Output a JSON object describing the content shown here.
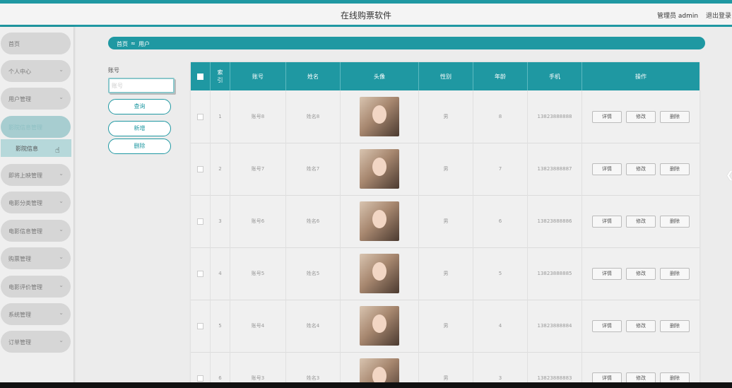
{
  "app": {
    "title": "在线购票软件",
    "admin_text": "管理员 admin",
    "logout": "退出登录"
  },
  "sidebar": {
    "items": [
      {
        "label": "首页",
        "chevron": ""
      },
      {
        "label": "个人中心",
        "chevron": "⌄"
      },
      {
        "label": "用户管理",
        "chevron": "⌄"
      },
      {
        "label": "影院信息管理",
        "chevron": ""
      },
      {
        "label": "即将上映管理",
        "chevron": "⌄"
      },
      {
        "label": "电影分类管理",
        "chevron": "⌄"
      },
      {
        "label": "电影信息管理",
        "chevron": "⌄"
      },
      {
        "label": "购票管理",
        "chevron": "⌄"
      },
      {
        "label": "电影评价管理",
        "chevron": "⌄"
      },
      {
        "label": "系统管理",
        "chevron": "⌄"
      },
      {
        "label": "订单管理",
        "chevron": "⌄"
      }
    ],
    "active_sub": "影院信息"
  },
  "breadcrumb": {
    "home": "首页",
    "sep": "≈",
    "current": "用户"
  },
  "search": {
    "label": "账号",
    "placeholder": "账号",
    "query": "查询",
    "add": "新增",
    "delete": "删除"
  },
  "table": {
    "headers": {
      "index": "索引",
      "account": "账号",
      "name": "姓名",
      "avatar": "头像",
      "gender": "性别",
      "age": "年龄",
      "phone": "手机",
      "ops": "操作"
    },
    "rows": [
      {
        "index": "1",
        "account": "账号8",
        "name": "姓名8",
        "gender": "男",
        "age": "8",
        "phone": "13823888888"
      },
      {
        "index": "2",
        "account": "账号7",
        "name": "姓名7",
        "gender": "男",
        "age": "7",
        "phone": "13823888887"
      },
      {
        "index": "3",
        "account": "账号6",
        "name": "姓名6",
        "gender": "男",
        "age": "6",
        "phone": "13823888886"
      },
      {
        "index": "4",
        "account": "账号5",
        "name": "姓名5",
        "gender": "男",
        "age": "5",
        "phone": "13823888885"
      },
      {
        "index": "5",
        "account": "账号4",
        "name": "姓名4",
        "gender": "男",
        "age": "4",
        "phone": "13823888884"
      },
      {
        "index": "6",
        "account": "账号3",
        "name": "姓名3",
        "gender": "男",
        "age": "3",
        "phone": "13823888883"
      }
    ],
    "actions": {
      "detail": "详情",
      "edit": "修改",
      "delete": "删除"
    }
  },
  "icons": {
    "cursor": "pointer-cursor-icon",
    "chevron": "chevron-down-icon",
    "right_arrow": "chevron-left-icon"
  },
  "colors": {
    "accent": "#1f98a2",
    "active_nav": "#a7cdd0"
  }
}
